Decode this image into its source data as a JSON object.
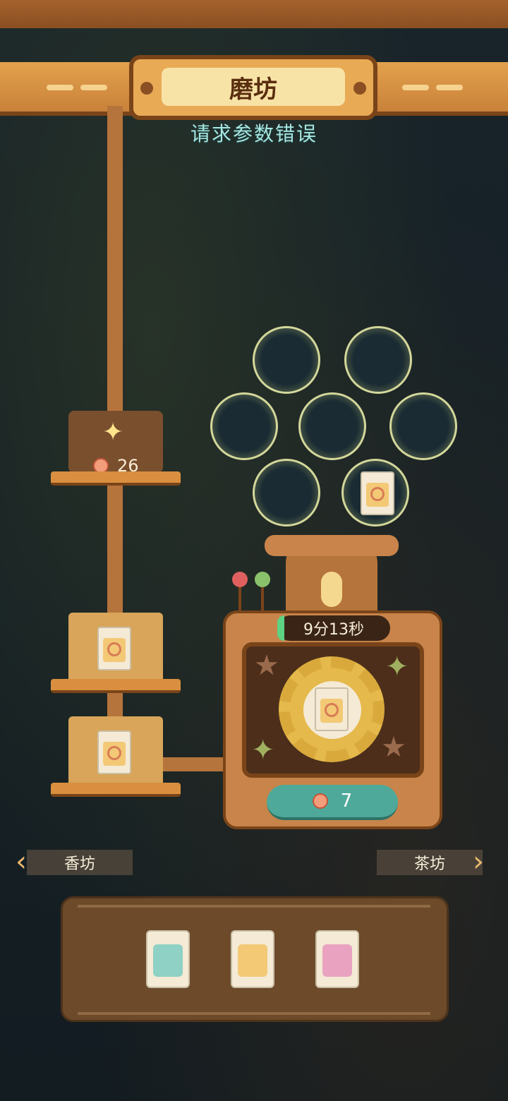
{
  "header": {
    "title": "磨坊",
    "subtitle": "请求参数错误"
  },
  "counter": {
    "value": "26",
    "icon": "sparkle-icon"
  },
  "machine": {
    "timer": "9分13秒",
    "cost": "7",
    "cost_icon": "flower-coin-icon"
  },
  "nav": {
    "left_label": "香坊",
    "right_label": "茶坊"
  },
  "slots": {
    "total": 7,
    "filled": 1
  },
  "queue": {
    "count": 2,
    "item": "spiral-packet"
  },
  "tray": {
    "items": [
      {
        "name": "bee-packet",
        "color": "#8fd1c4"
      },
      {
        "name": "spiral-packet",
        "color": "#f3c976"
      },
      {
        "name": "spider-packet",
        "color": "#e9a3c1"
      }
    ]
  },
  "colors": {
    "wood": "#c8844a",
    "accent_green": "#4fa99a",
    "subtitle": "#a7e7e2"
  }
}
